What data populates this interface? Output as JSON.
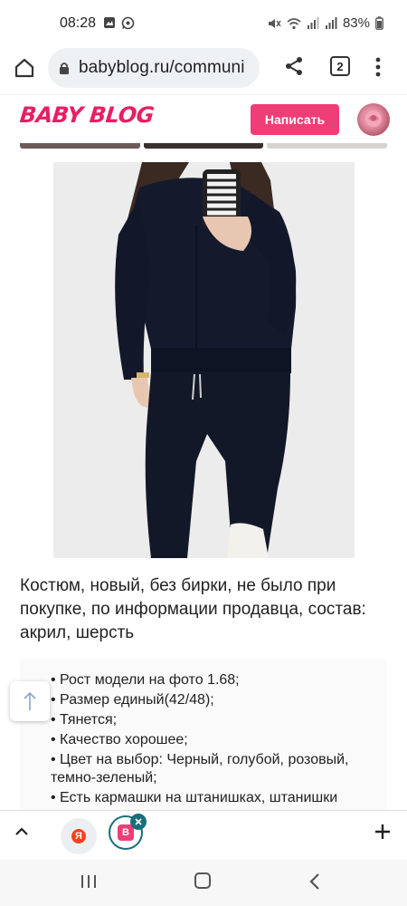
{
  "status_bar": {
    "time": "08:28",
    "battery": "83%"
  },
  "browser": {
    "url": "babyblog.ru/communi",
    "tab_count": "2"
  },
  "site": {
    "logo": "BABY BLOG",
    "write_button": "Написать",
    "accent_color": "#ef3d78"
  },
  "post": {
    "description": "Костюм, новый, без бирки, не было при покупке, по информации продавца, состав: акрил, шерсть",
    "features": [
      "Рост модели на фото 1.68;",
      "Размер единый(42/48);",
      "Тянется;",
      "Качество хорошее;",
      "Цвет на выбор: Черный, голубой, розовый, темно-зеленый;",
      "Есть кармашки на штанишках, штанишки зауженные;"
    ]
  },
  "bottom_bar": {
    "yandex_label": "Я",
    "tab_badge": "B"
  }
}
